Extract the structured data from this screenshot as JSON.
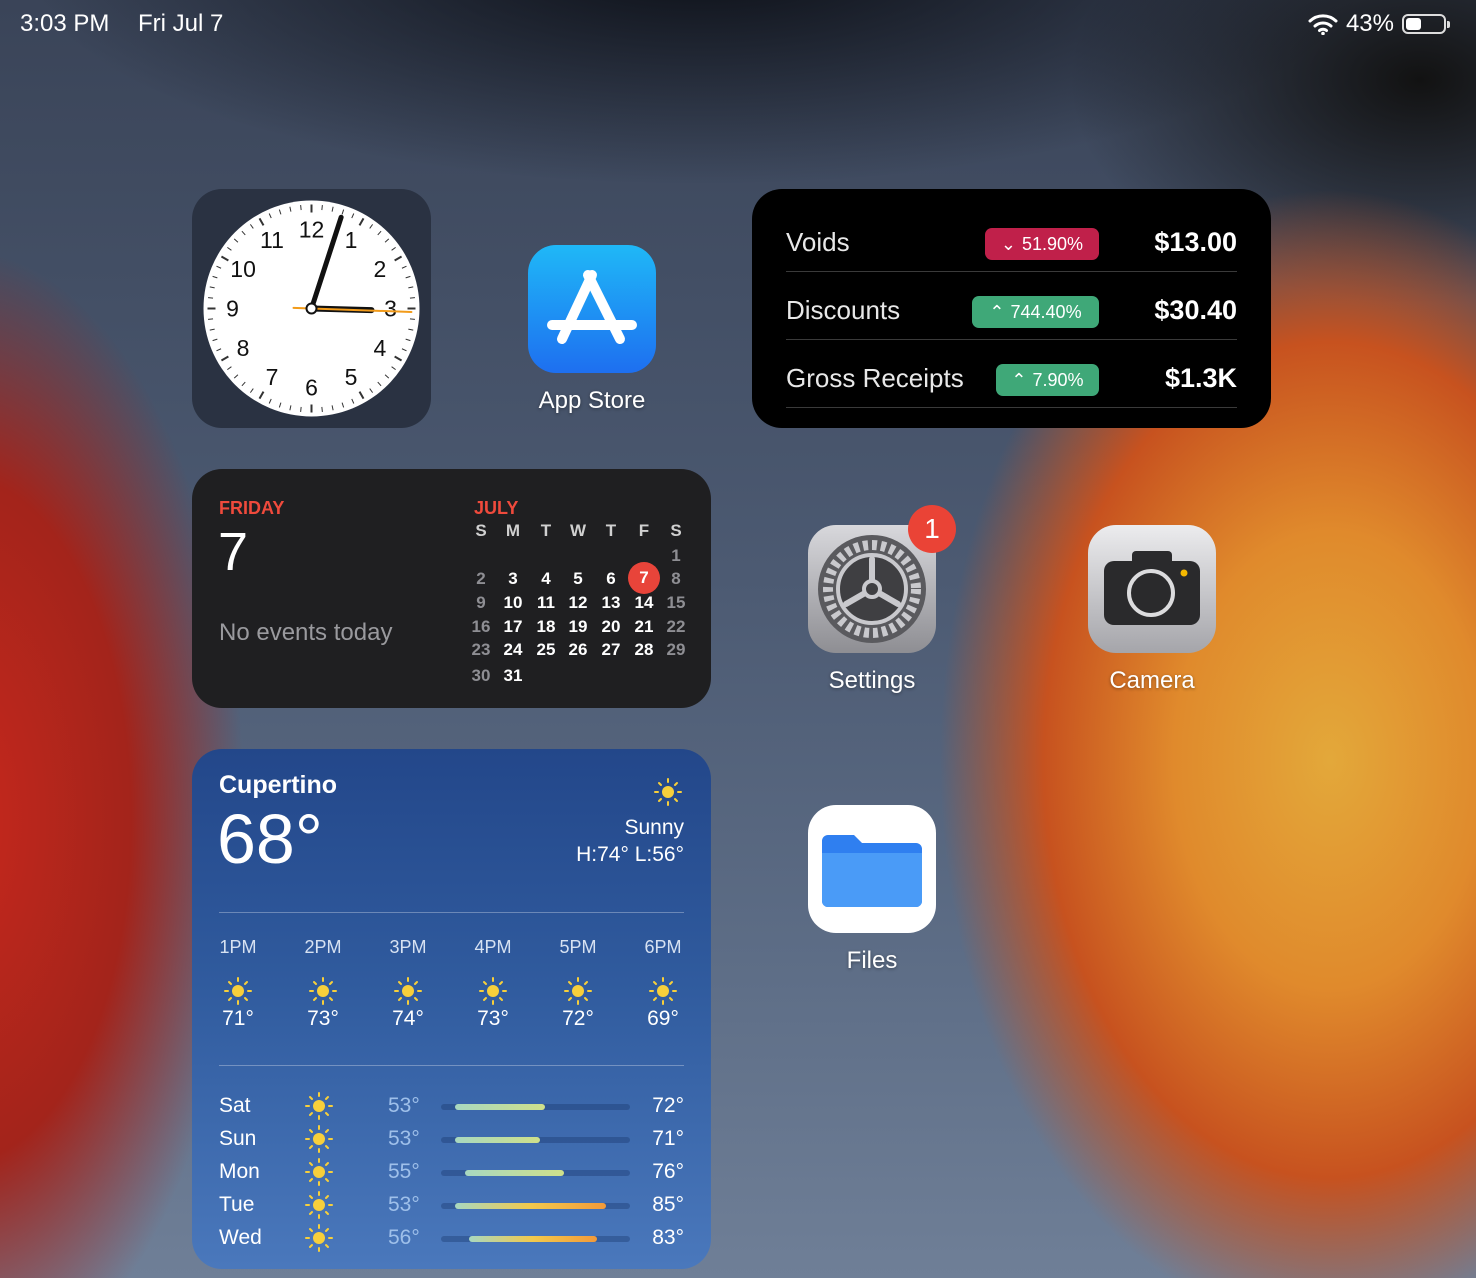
{
  "status_bar": {
    "time": "3:03 PM",
    "date": "Fri Jul 7",
    "battery": "43%",
    "battery_level": 0.43
  },
  "clock": {
    "numbers": [
      "12",
      "1",
      "2",
      "3",
      "4",
      "5",
      "6",
      "7",
      "8",
      "9",
      "10",
      "11"
    ],
    "time": "3:03"
  },
  "sales_widget": {
    "rows": [
      {
        "label": "Voids",
        "change": "51.90%",
        "direction": "down",
        "value": "$13.00",
        "color": "#c0204a"
      },
      {
        "label": "Discounts",
        "change": "744.40%",
        "direction": "up",
        "value": "$30.40",
        "color": "#3fa878"
      },
      {
        "label": "Gross Receipts",
        "change": "7.90%",
        "direction": "up",
        "value": "$1.3K",
        "color": "#3fa878"
      }
    ]
  },
  "calendar": {
    "weekday": "FRIDAY",
    "day": "7",
    "no_events": "No events today",
    "month": "JULY",
    "headers": [
      "S",
      "M",
      "T",
      "W",
      "T",
      "F",
      "S"
    ],
    "weeks": [
      [
        "",
        "",
        "",
        "",
        "",
        "",
        "1"
      ],
      [
        "2",
        "3",
        "4",
        "5",
        "6",
        "7",
        "8"
      ],
      [
        "9",
        "10",
        "11",
        "12",
        "13",
        "14",
        "15"
      ],
      [
        "16",
        "17",
        "18",
        "19",
        "20",
        "21",
        "22"
      ],
      [
        "23",
        "24",
        "25",
        "26",
        "27",
        "28",
        "29"
      ],
      [
        "30",
        "31",
        "",
        "",
        "",
        "",
        ""
      ]
    ],
    "today": "7",
    "accent": "#ef4a3c"
  },
  "weather": {
    "city": "Cupertino",
    "temp": "68°",
    "icon": "sun-icon",
    "condition": "Sunny",
    "high_low": "H:74° L:56°",
    "hourly": [
      {
        "time": "1PM",
        "temp": "71°"
      },
      {
        "time": "2PM",
        "temp": "73°"
      },
      {
        "time": "3PM",
        "temp": "74°"
      },
      {
        "time": "4PM",
        "temp": "73°"
      },
      {
        "time": "5PM",
        "temp": "72°"
      },
      {
        "time": "6PM",
        "temp": "69°"
      }
    ],
    "daily": [
      {
        "day": "Sat",
        "low": "53°",
        "high": "72°",
        "low_val": 53,
        "high_val": 72
      },
      {
        "day": "Sun",
        "low": "53°",
        "high": "71°",
        "low_val": 53,
        "high_val": 71
      },
      {
        "day": "Mon",
        "low": "55°",
        "high": "76°",
        "low_val": 55,
        "high_val": 76
      },
      {
        "day": "Tue",
        "low": "53°",
        "high": "85°",
        "low_val": 53,
        "high_val": 85
      },
      {
        "day": "Wed",
        "low": "56°",
        "high": "83°",
        "low_val": 56,
        "high_val": 83
      }
    ]
  },
  "apps": {
    "app_store": {
      "name": "App Store",
      "icon": "app-store-icon"
    },
    "settings": {
      "name": "Settings",
      "icon": "gear-icon",
      "badge": "1"
    },
    "camera": {
      "name": "Camera",
      "icon": "camera-icon"
    },
    "files": {
      "name": "Files",
      "icon": "folder-icon"
    }
  }
}
